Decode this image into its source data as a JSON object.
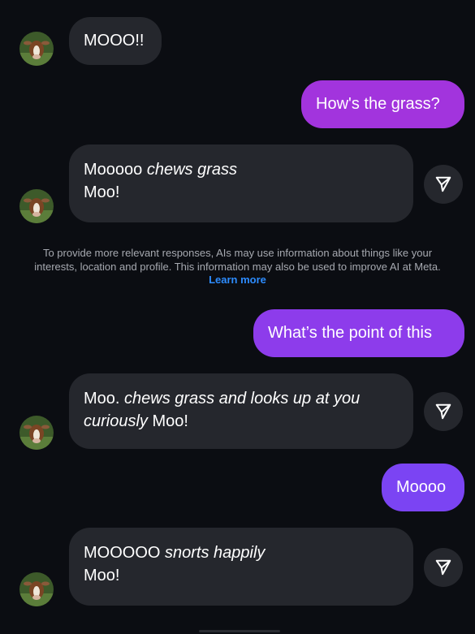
{
  "colors": {
    "background": "#0b0d12",
    "bot_bubble": "#25272d",
    "user_bubble_magenta": "#a234dd",
    "user_bubble_purple": "#7b44f3",
    "link": "#2d8cff"
  },
  "messages": {
    "m1": {
      "text": "MOOO!!"
    },
    "m2": {
      "text": "How's the grass?"
    },
    "m3": {
      "plain1": "Mooooo ",
      "italic1": "chews grass",
      "line2": "Moo!"
    },
    "m4": {
      "text": "What’s the point of this"
    },
    "m5": {
      "plain1": "Moo. ",
      "italic1": "chews grass and looks up at you curiously",
      "plain2": " Moo!"
    },
    "m6": {
      "text": "Moooo"
    },
    "m7": {
      "plain1": "MOOOOO ",
      "italic1": "snorts happily",
      "line2": "Moo!"
    }
  },
  "disclaimer": {
    "text": "To provide more relevant responses, AIs may use information about things like your interests, location and profile. This information may also be used to improve AI at Meta. ",
    "link": "Learn more"
  },
  "icons": {
    "avatar": "cow-avatar",
    "share": "send-icon"
  }
}
